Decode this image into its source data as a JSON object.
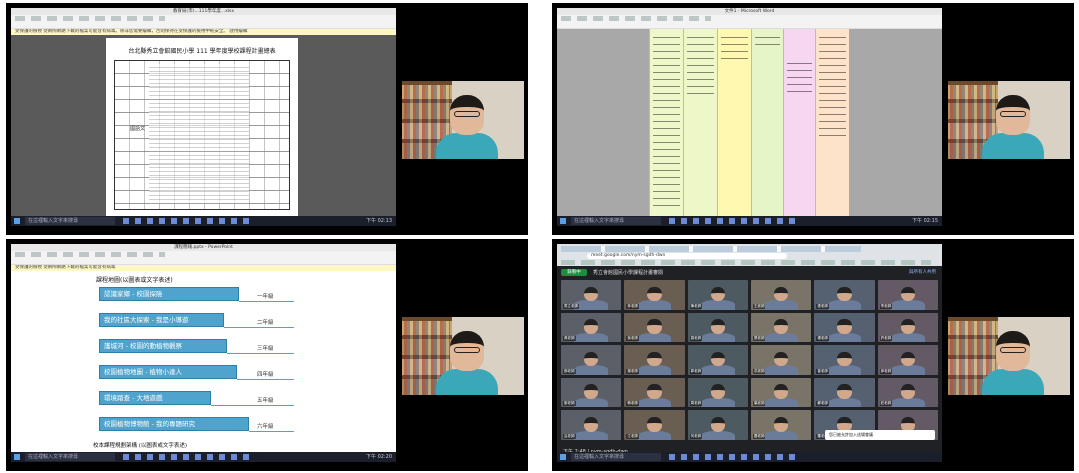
{
  "q1": {
    "window_title": "教育局(市)...111學年度...xlsx",
    "bar_text": "受保護的檢視 從網際網路下載的檔案可能含有病毒。除非您需要編輯，否則保持在受保護的檢視中較安全。 啟用編輯",
    "doc_title": "台北縣秀立會館國民小學 111 學年度學校課程計畫總表",
    "group_label": "國語文",
    "taskbar_search": "在這裡輸入文字來搜尋",
    "clock": "下午 02:13"
  },
  "q2": {
    "window_title": "文件1 - Microsoft Word",
    "taskbar_search": "在這裡輸入文字來搜尋",
    "clock": "下午 02:15"
  },
  "q3": {
    "window_title": "課程簡報.pptx - PowerPoint",
    "bar_text": "受保護的檢視 從網際網路下載的檔案可能含有病毒",
    "heading": "課程地圖(以圖表或文字表述)",
    "steps": [
      {
        "label": "認識家鄉 - 校園探險",
        "grade": "一年級"
      },
      {
        "label": "我的社區大探索 - 我是小導遊",
        "grade": "二年級"
      },
      {
        "label": "護城河 - 校園的動植物觀察",
        "grade": "三年級"
      },
      {
        "label": "校園植物地圖 - 植物小達人",
        "grade": "四年級"
      },
      {
        "label": "環境踏查 - 大地遊戲",
        "grade": "五年級"
      },
      {
        "label": "校園植物博物館 - 我的專題研究",
        "grade": "六年級"
      }
    ],
    "footer": "校本課程規劃架構 (以圖表或文字表述)",
    "taskbar_search": "在這裡輸入文字來搜尋",
    "clock": "下午 02:20"
  },
  "q4": {
    "address": "meet.google.com/nym-sgdh-dwn",
    "badge": "錄製中",
    "meeting_title": "秀立會館國民小學課程計畫審閱",
    "right_label": "與所有人共用",
    "time": "下午 2:48 | nym-sgdh-dwn",
    "toast": "您已被允許加入這場會議",
    "taskbar_search": "在這裡輸入文字來搜尋",
    "participants": [
      "秀立老師",
      "林老師",
      "陳老師",
      "王老師",
      "張老師",
      "李老師",
      "黃老師",
      "吳老師",
      "劉老師",
      "蔡老師",
      "楊老師",
      "許老師",
      "鄭老師",
      "謝老師",
      "郭老師",
      "洪老師",
      "曾老師",
      "邱老師",
      "廖老師",
      "賴老師",
      "周老師",
      "葉老師",
      "蘇老師",
      "莊老師",
      "呂老師",
      "江老師",
      "何老師",
      "蕭老師",
      "羅老師",
      "高老師"
    ]
  }
}
